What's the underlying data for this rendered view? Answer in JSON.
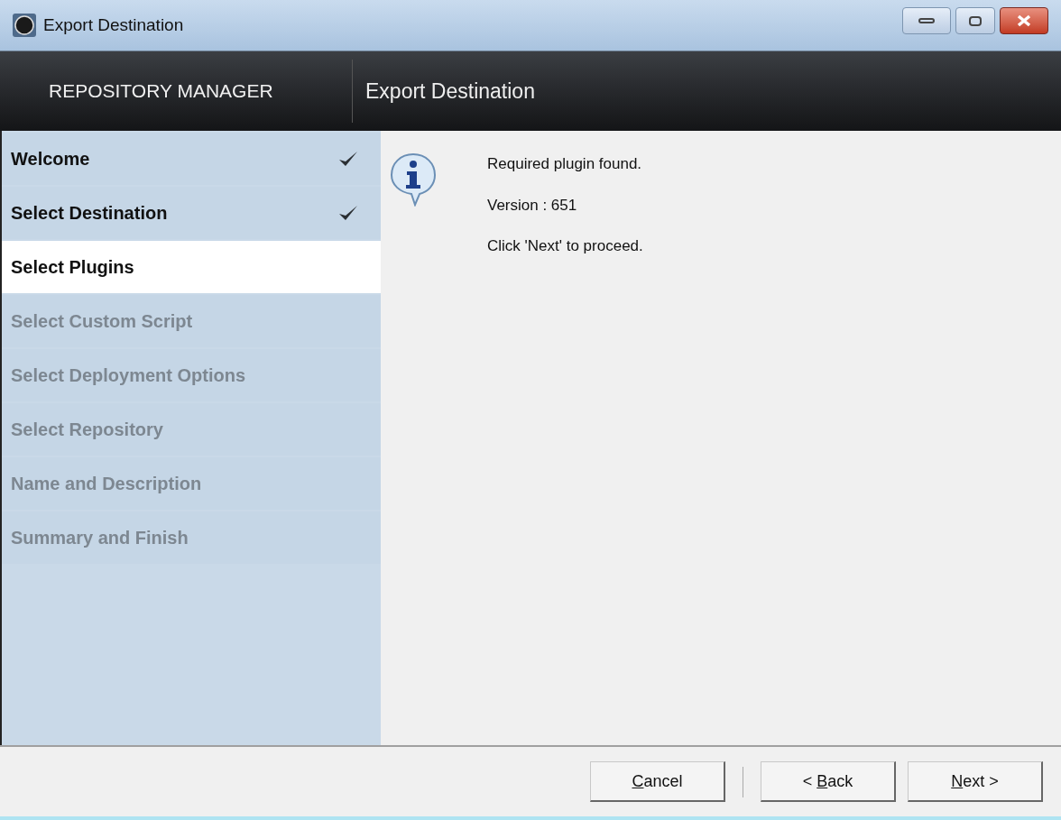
{
  "window": {
    "title": "Export Destination"
  },
  "header": {
    "product": "REPOSITORY MANAGER",
    "page_title": "Export Destination"
  },
  "steps": [
    {
      "label": "Welcome",
      "selected": false,
      "checked": true,
      "disabled": false
    },
    {
      "label": "Select Destination",
      "selected": false,
      "checked": true,
      "disabled": false
    },
    {
      "label": "Select Plugins",
      "selected": true,
      "checked": false,
      "disabled": false
    },
    {
      "label": "Select Custom Script",
      "selected": false,
      "checked": false,
      "disabled": true
    },
    {
      "label": "Select Deployment Options",
      "selected": false,
      "checked": false,
      "disabled": true
    },
    {
      "label": "Select Repository",
      "selected": false,
      "checked": false,
      "disabled": true
    },
    {
      "label": "Name and Description",
      "selected": false,
      "checked": false,
      "disabled": true
    },
    {
      "label": "Summary and Finish",
      "selected": false,
      "checked": false,
      "disabled": true
    }
  ],
  "messages": [
    "Required plugin found.",
    "Version : 651",
    "Click 'Next' to proceed."
  ],
  "buttons": [
    {
      "accelerator": "C",
      "after": "ancel"
    },
    {
      "before": "< ",
      "accelerator": "B",
      "after": "ack"
    },
    {
      "accelerator": "N",
      "after": "ext >"
    }
  ]
}
